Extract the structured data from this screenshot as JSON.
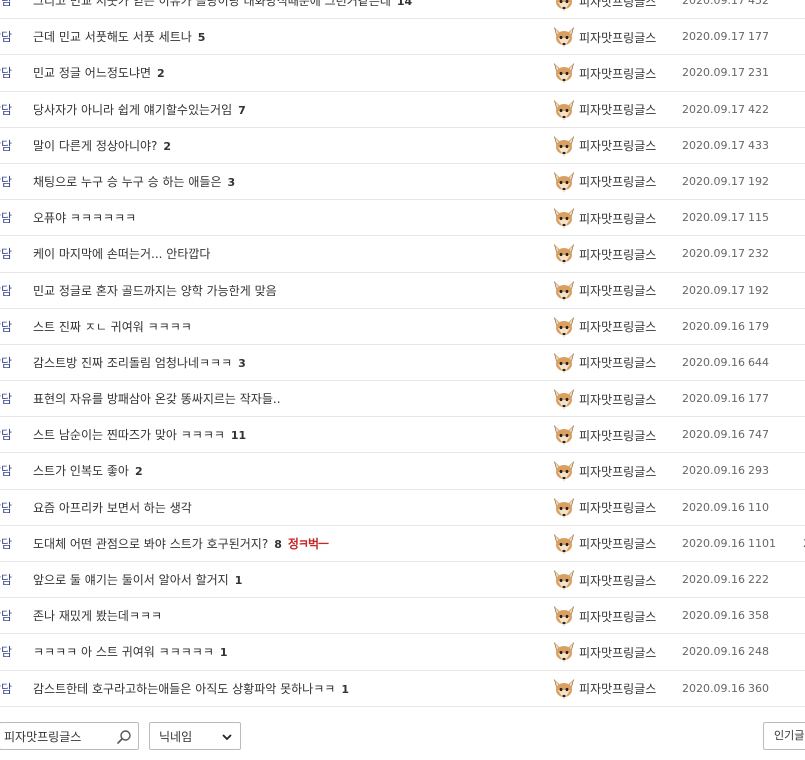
{
  "rows": [
    {
      "category": "잡담",
      "title": "그리고 민교 서풋가 얻는 이유가 클랑이랑 대화방식때문에 그런거같은데",
      "replies": "14",
      "writer": "피자맛프링글스",
      "date": "2020.09.17",
      "views": "452"
    },
    {
      "category": "잡담",
      "title": "근데 민교 서풋해도 서풋 세트나",
      "replies": "5",
      "writer": "피자맛프링글스",
      "date": "2020.09.17",
      "views": "177"
    },
    {
      "category": "잡담",
      "title": "민교 정글 어느정도냐면",
      "replies": "2",
      "writer": "피자맛프링글스",
      "date": "2020.09.17",
      "views": "231"
    },
    {
      "category": "잡담",
      "title": "당사자가 아니라 쉽게 얘기할수있는거임",
      "replies": "7",
      "writer": "피자맛프링글스",
      "date": "2020.09.17",
      "views": "422"
    },
    {
      "category": "잡담",
      "title": "말이 다른게 정상아니야?",
      "replies": "2",
      "writer": "피자맛프링글스",
      "date": "2020.09.17",
      "views": "433"
    },
    {
      "category": "잡담",
      "title": "채팅으로 누구 승 누구 승 하는 애들은",
      "replies": "3",
      "writer": "피자맛프링글스",
      "date": "2020.09.17",
      "views": "192"
    },
    {
      "category": "잡담",
      "title": "오퓨야 ㅋㅋㅋㅋㅋㅋ",
      "replies": "",
      "writer": "피자맛프링글스",
      "date": "2020.09.17",
      "views": "115"
    },
    {
      "category": "잡담",
      "title": "케이 마지막에 손떠는거... 안타깝다",
      "replies": "",
      "writer": "피자맛프링글스",
      "date": "2020.09.17",
      "views": "232"
    },
    {
      "category": "잡담",
      "title": "민교 정글로 혼자 골드까지는 양학 가능한게 맞음",
      "replies": "",
      "writer": "피자맛프링글스",
      "date": "2020.09.17",
      "views": "192"
    },
    {
      "category": "잡담",
      "title": "스트 진짜 ㅈㄴ 귀여워 ㅋㅋㅋㅋ",
      "replies": "",
      "writer": "피자맛프링글스",
      "date": "2020.09.16",
      "views": "179"
    },
    {
      "category": "잡담",
      "title": "감스트방 진짜 조리돌림 엄청나네ㅋㅋㅋ",
      "replies": "3",
      "writer": "피자맛프링글스",
      "date": "2020.09.16",
      "views": "644"
    },
    {
      "category": "잡담",
      "title": "표현의 자유를 방패삼아 온갖 똥싸지르는 작자들..",
      "replies": "",
      "writer": "피자맛프링글스",
      "date": "2020.09.16",
      "views": "177"
    },
    {
      "category": "잡담",
      "title": "스트 남순이는 찐따즈가 맞아 ㅋㅋㅋㅋ",
      "replies": "11",
      "writer": "피자맛프링글스",
      "date": "2020.09.16",
      "views": "747"
    },
    {
      "category": "잡담",
      "title": "스트가 인복도 좋아",
      "replies": "2",
      "writer": "피자맛프링글스",
      "date": "2020.09.16",
      "views": "293"
    },
    {
      "category": "잡담",
      "title": "요즘 아프리카 보면서 하는 생각",
      "replies": "",
      "writer": "피자맛프링글스",
      "date": "2020.09.16",
      "views": "110"
    },
    {
      "category": "잡담",
      "title": "도대체 어떤 관점으로 봐야 스트가 호구된거지?",
      "replies": "8",
      "badge": "정ㅋ벅ㅡ",
      "writer": "피자맛프링글스",
      "date": "2020.09.16",
      "views": "1101",
      "extra": "2"
    },
    {
      "category": "잡담",
      "title": "앞으로 둘 얘기는 둘이서 알아서 할거지",
      "replies": "1",
      "writer": "피자맛프링글스",
      "date": "2020.09.16",
      "views": "222"
    },
    {
      "category": "잡담",
      "title": "존나 재밌게 봤는데ㅋㅋㅋ",
      "replies": "",
      "writer": "피자맛프링글스",
      "date": "2020.09.16",
      "views": "358"
    },
    {
      "category": "잡담",
      "title": "ㅋㅋㅋㅋ 아 스트 귀여워 ㅋㅋㅋㅋㅋ",
      "replies": "1",
      "writer": "피자맛프링글스",
      "date": "2020.09.16",
      "views": "248"
    },
    {
      "category": "잡담",
      "title": "감스트한테 호구라고하는애들은 아직도 상황파악 못하나ㅋㅋ",
      "replies": "1",
      "writer": "피자맛프링글스",
      "date": "2020.09.16",
      "views": "360"
    }
  ],
  "search": {
    "value": "피자맛프링글스",
    "type_selected": "닉네임",
    "popular_button": "인기글"
  },
  "colors": {
    "category": "#3b4890",
    "badge": "#c62828",
    "border": "#e6e6e6"
  },
  "icons": {
    "avatar": "fox-avatar-icon",
    "search": "magnifier-icon",
    "dropdown": "chevron-down-icon"
  }
}
